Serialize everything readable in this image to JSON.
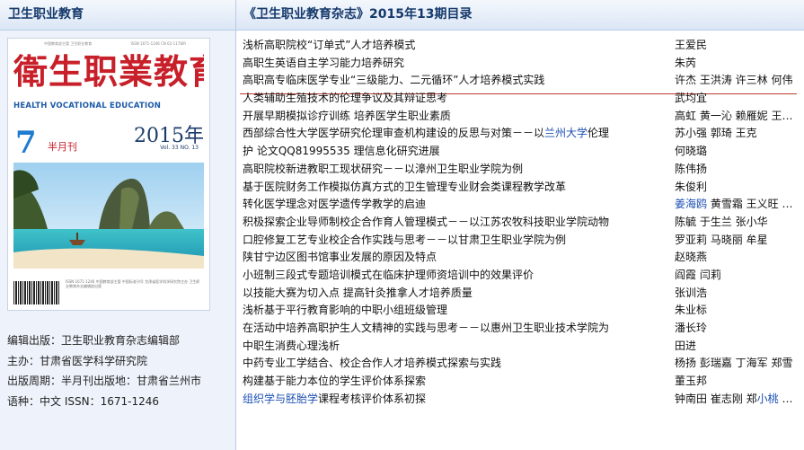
{
  "left_panel": {
    "header": "卫生职业教育",
    "cover": {
      "tiny_top": "中国教育部主管 卫生职业教育",
      "issn_small": "ISSN 1671-1246 CN 62-1178/R",
      "title_brush": "衛生职業教育",
      "title_en": "HEALTH VOCATIONAL EDUCATION",
      "year": "2015年",
      "issue_number": "7",
      "semimonthly": "半月刊",
      "vol": "Vol. 33  NO. 13",
      "small_print": "ISSN 1671-1246 中国教育部主管 中国标准刊号 甘肃省医学科学研究院主办 卫生职业教育杂志编辑部出版"
    },
    "info": [
      {
        "label": "编辑出版：",
        "value": "卫生职业教育杂志编辑部"
      },
      {
        "label": "主办：",
        "value": "甘肃省医学科学研究院"
      },
      {
        "label": "出版周期：",
        "value": "半月刊出版地：甘肃省兰州市"
      },
      {
        "label": "语种：",
        "value": "中文    ISSN：1671-1246"
      }
    ]
  },
  "right_panel": {
    "header": "《卫生职业教育杂志》2015年13期目录",
    "articles": [
      {
        "title": "浅析高职院校“订单式”人才培养模式",
        "authors": "王爱民"
      },
      {
        "title": "高职生英语自主学习能力培养研究",
        "authors": "朱芮"
      },
      {
        "title": "高职高专临床医学专业“三级能力、二元循环”人才培养模式实践",
        "authors": "许杰 王洪涛 许三林 何伟"
      },
      {
        "title": "人类辅助生殖技术的伦理争议及其辩证思考",
        "authors": "武均宜"
      },
      {
        "title": "开展早期模拟诊疗训练 培养医学生职业素质",
        "authors": "高虹 黄一沁 赖雁妮 王…"
      },
      {
        "title_parts": [
          "西部综合性大学医学研究伦理审查机构建设的反思与对策－－以",
          "兰州大学",
          "伦理"
        ],
        "authors": "苏小强 郭琦 王克"
      },
      {
        "title": "护 论文QQ81995535 理信息化研究进展",
        "authors": "何晓璐"
      },
      {
        "title": "高职院校新进教职工现状研究－－以漳州卫生职业学院为例",
        "authors": "陈伟扬"
      },
      {
        "title": "基于医院财务工作模拟仿真方式的卫生管理专业财会类课程教学改革",
        "authors": "朱俊利"
      },
      {
        "title": "转化医学理念对医学遗传学教学的启迪",
        "authors_parts": [
          "姜海鸥",
          " 黄雪霜 王义旺 …"
        ]
      },
      {
        "title": "积极探索企业导师制校企合作育人管理模式－－以江苏农牧科技职业学院动物",
        "authors": "陈毓 于生兰 张小华"
      },
      {
        "title": "口腔修复工艺专业校企合作实践与思考－－以甘肃卫生职业学院为例",
        "authors": "罗亚莉 马晓丽 牟星"
      },
      {
        "title": "陕甘宁边区图书馆事业发展的原因及特点",
        "authors": "赵晓燕"
      },
      {
        "title": "小班制三段式专题培训模式在临床护理师资培训中的效果评价",
        "authors": "阎霞 闫莉"
      },
      {
        "title": "以技能大赛为切入点 提高针灸推拿人才培养质量",
        "authors": "张训浩"
      },
      {
        "title": "浅析基于平行教育影响的中职小组班级管理",
        "authors": "朱业标"
      },
      {
        "title": "在活动中培养高职护生人文精神的实践与思考－－以惠州卫生职业技术学院为",
        "authors": "潘长玲"
      },
      {
        "title": "中职生消费心理浅析",
        "authors": "田进"
      },
      {
        "title": "中药专业工学结合、校企合作人才培养模式探索与实践",
        "authors": "杨扬 彭瑞嘉 丁海军 郑雪"
      },
      {
        "title": "构建基于能力本位的学生评价体系探索",
        "authors": "董玉邦"
      },
      {
        "title_parts": [
          "组织学与胚胎学",
          "课程考核评价体系初探"
        ],
        "authors_parts": [
          "钟南田 崔志刚 郑",
          "小桃",
          " …"
        ]
      }
    ]
  },
  "colors": {
    "header_text": "#15396b",
    "link": "#1a4fb3",
    "highlight_line": "#c0392b",
    "left_bg": "#eef3fb"
  }
}
